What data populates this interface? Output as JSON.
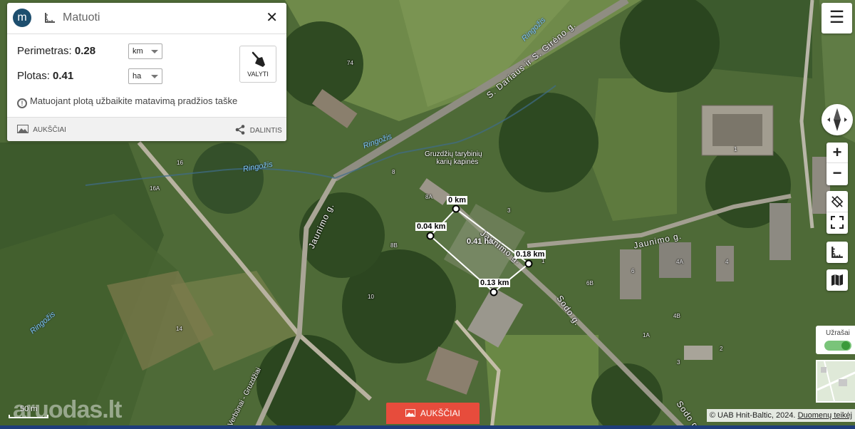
{
  "panel": {
    "logo_letter": "m",
    "title": "Matuoti",
    "close_label": "✕",
    "perimeter_label": "Perimetras:",
    "perimeter_value": "0.28",
    "perimeter_unit": "km",
    "area_label": "Plotas:",
    "area_value": "0.41",
    "area_unit": "ha",
    "clear_label": "VALYTI",
    "hint": "Matuojant plotą užbaikite matavimą pradžios taške",
    "elevation_label": "AUKŠČIAI",
    "share_label": "DALINTIS"
  },
  "measure_labels": {
    "p0": "0 km",
    "p1": "0.04 km",
    "p2": "0.13 km",
    "p3": "0.18 km",
    "area": "0.41 ha"
  },
  "map_labels": {
    "cemetery_line1": "Gruzdžių tarybinių",
    "cemetery_line2": "karių kapinės",
    "street_darius": "S. Dariaus ir S. Girėno g.",
    "street_jaunimo_left": "Jaunimo g.",
    "street_jaunimo_mid": "Jaunimo g.",
    "street_jaunimo_right": "Jaunimo g.",
    "street_sodo": "Sodo g.",
    "street_sodo2": "Sodo g.",
    "street_gruzdziai": "Verbūnai - Gruzdžiai",
    "river1": "Ringožis",
    "river2": "Ringožis",
    "river3": "Ringožis",
    "river4": "Ringožis",
    "h74": "74",
    "h16": "16",
    "h16a": "16A",
    "h8": "8",
    "h8a": "8A",
    "h3": "3",
    "h8b": "8B",
    "h10": "10",
    "h14": "14",
    "h1": "1",
    "h6": "6",
    "h6b": "6B",
    "h4a": "4A",
    "h4": "4",
    "h4b": "4B",
    "h1b": "1",
    "h3b": "3",
    "h2": "2",
    "h1a": "1A"
  },
  "controls": {
    "menu": "☰",
    "zoom_in": "+",
    "zoom_out": "−",
    "underlay_label": "Užrašai",
    "underlay_on": true
  },
  "footer": {
    "attribution_prefix": "© UAB Hnit-Baltic, 2024.",
    "attribution_link": "Duomenų teikėj",
    "elevation_button": "AUKŠČIAI",
    "scale": "50 m",
    "watermark": "aruodas.lt"
  },
  "colors": {
    "accent": "#e74c3c",
    "logo": "#1d4e6e",
    "water": "#7fc8f0",
    "toggle": "#3a9a3a"
  }
}
